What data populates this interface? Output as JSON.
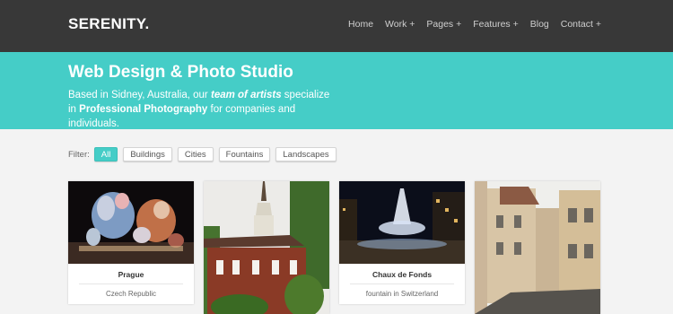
{
  "brand": {
    "logo": "SERENITY."
  },
  "nav": {
    "items": [
      "Home",
      "Work +",
      "Pages +",
      "Features +",
      "Blog",
      "Contact +"
    ]
  },
  "hero": {
    "title": "Web Design & Photo Studio",
    "line1_prefix": "Based in Sidney, Australia, our",
    "line1_emph": "team of artists",
    "line1_suffix": "specialize in",
    "line2_strong": "Professional Photography",
    "line2_suffix": "for companies and individuals."
  },
  "filter": {
    "label": "Filter:",
    "options": [
      "All",
      "Buildings",
      "Cities",
      "Fountains",
      "Landscapes"
    ],
    "active": "All"
  },
  "portfolio": {
    "items": [
      {
        "title": "Prague",
        "subtitle": "Czech Republic",
        "image": "illuminated-sculptures-photo"
      },
      {
        "title": "",
        "subtitle": "",
        "image": "brick-building-photo"
      },
      {
        "title": "Chaux de Fonds",
        "subtitle": "fountain in Switzerland",
        "image": "night-fountain-photo"
      },
      {
        "title": "",
        "subtitle": "",
        "image": "old-street-photo"
      }
    ]
  },
  "colors": {
    "topbar": "#383838",
    "accent": "#45cdc7",
    "page": "#f3f3f3"
  }
}
